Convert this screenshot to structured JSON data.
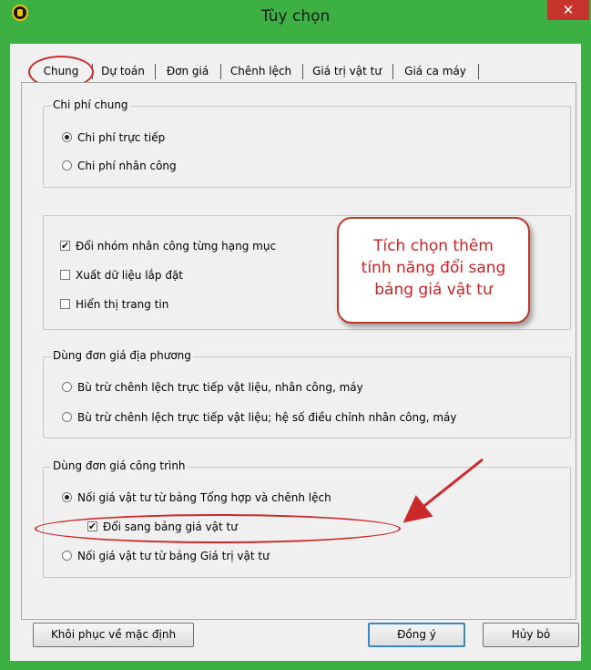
{
  "window": {
    "title": "Tùy chọn",
    "close_glyph": "✕"
  },
  "tabs": [
    {
      "label": "Chung",
      "active": true
    },
    {
      "label": "Dự toán"
    },
    {
      "label": "Đơn giá"
    },
    {
      "label": "Chênh lệch"
    },
    {
      "label": "Giá trị vật tư"
    },
    {
      "label": "Giá ca máy"
    }
  ],
  "group_chi_phi_chung": {
    "legend": "Chi phí chung",
    "options": [
      "Chi phí trực tiếp",
      "Chi phí nhân công"
    ],
    "selected": 0
  },
  "group_misc": {
    "options": [
      {
        "label": "Đổi nhóm nhân công từng hạng mục",
        "checked": true
      },
      {
        "label": "Xuất dữ liệu lắp đặt",
        "checked": false
      },
      {
        "label": "Hiển thị trang tin",
        "checked": false
      }
    ]
  },
  "group_dia_phuong": {
    "legend": "Dùng đơn giá địa phương",
    "options": [
      "Bù trừ chênh lệch trực tiếp vật liệu, nhân công, máy",
      "Bù trừ chênh lệch trực tiếp vật liệu; hệ số điều chỉnh nhân công, máy"
    ],
    "selected": -1
  },
  "group_cong_trinh": {
    "legend": "Dùng đơn giá công trình",
    "option_1": "Nối giá vật tư từ bảng Tổng hợp và chênh lệch",
    "sub_check": "Đổi sang bảng giá vật tư",
    "sub_checked": true,
    "option_2": "Nối giá vật tư từ bảng Giá trị vật tư",
    "selected": 0
  },
  "callout": {
    "line1": "Tích chọn thêm",
    "line2": "tính năng đổi sang",
    "line3": "bảng giá vật tư"
  },
  "buttons": {
    "restore": "Khôi phục về mặc định",
    "ok": "Đồng ý",
    "cancel": "Hủy bỏ"
  },
  "colors": {
    "window_frame": "#3cb043",
    "close_button": "#c7342b",
    "annotation_red": "#cc2a2a"
  },
  "icons": {
    "app": "app-logo-icon",
    "close": "close-icon"
  }
}
